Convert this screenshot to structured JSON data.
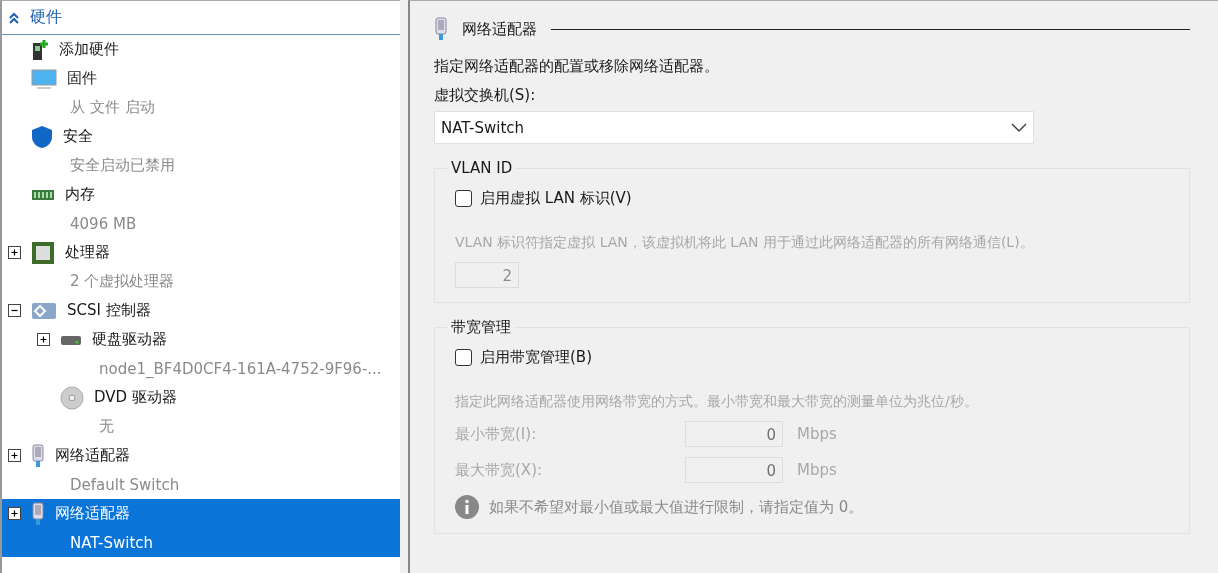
{
  "sidebar": {
    "title": "硬件",
    "expanded": true,
    "items": [
      {
        "kind": "add",
        "label": "添加硬件",
        "selected": false
      },
      {
        "kind": "firmware",
        "label": "固件",
        "detail": "从 文件 启动",
        "selected": false
      },
      {
        "kind": "security",
        "label": "安全",
        "detail": "安全启动已禁用",
        "selected": false
      },
      {
        "kind": "memory",
        "label": "内存",
        "detail": "4096 MB",
        "selected": false
      },
      {
        "kind": "processor",
        "label": "处理器",
        "detail": "2 个虚拟处理器",
        "expanded": false,
        "selected": false
      },
      {
        "kind": "scsi",
        "label": "SCSI 控制器",
        "expanded": true,
        "selected": false,
        "children": [
          {
            "kind": "disk",
            "label": "硬盘驱动器",
            "detail": "node1_BF4D0CF4-161A-4752-9F96-...",
            "expanded": false,
            "selected": false
          },
          {
            "kind": "dvd",
            "label": "DVD 驱动器",
            "detail": "无",
            "selected": false
          }
        ]
      },
      {
        "kind": "network",
        "label": "网络适配器",
        "detail": "Default Switch",
        "expanded": false,
        "selected": false
      },
      {
        "kind": "network",
        "label": "网络适配器",
        "detail": "NAT-Switch",
        "expanded": false,
        "selected": true
      }
    ]
  },
  "panel": {
    "title": "网络适配器",
    "description": "指定网络适配器的配置或移除网络适配器。",
    "switch_label": "虚拟交换机(S):",
    "switch_value": "NAT-Switch",
    "vlan": {
      "legend": "VLAN ID",
      "checkbox": {
        "label": "启用虚拟 LAN 标识(V)",
        "checked": false
      },
      "note": "VLAN 标识符指定虚拟 LAN，该虚拟机将此 LAN 用于通过此网络适配器的所有网络通信(L)。",
      "value": "2"
    },
    "bandwidth": {
      "legend": "带宽管理",
      "checkbox": {
        "label": "启用带宽管理(B)",
        "checked": false
      },
      "note": "指定此网络适配器使用网络带宽的方式。最小带宽和最大带宽的测量单位为兆位/秒。",
      "fields": [
        {
          "label": "最小带宽(I):",
          "value": "0",
          "unit": "Mbps"
        },
        {
          "label": "最大带宽(X):",
          "value": "0",
          "unit": "Mbps"
        }
      ],
      "info": "如果不希望对最小值或最大值进行限制，请指定值为 0。"
    }
  }
}
